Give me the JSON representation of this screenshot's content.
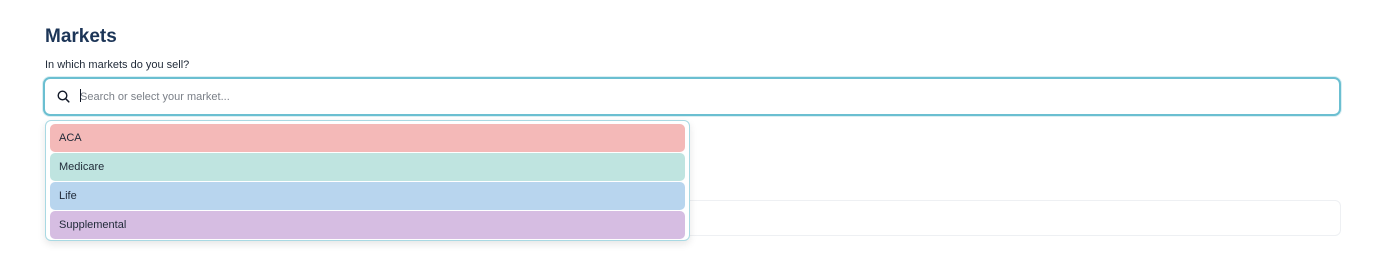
{
  "section": {
    "title": "Markets",
    "subtitle": "In which markets do you sell?"
  },
  "search": {
    "placeholder": "Search or select your market...",
    "value": "",
    "icon": "search-icon"
  },
  "dropdown": {
    "options": [
      {
        "label": "ACA",
        "color": "#f4b9b8"
      },
      {
        "label": "Medicare",
        "color": "#bfe4e0"
      },
      {
        "label": "Life",
        "color": "#b8d5ee"
      },
      {
        "label": "Supplemental",
        "color": "#d6bde2"
      }
    ]
  },
  "colors": {
    "accent": "#6bbfd1",
    "title": "#1c3557"
  }
}
